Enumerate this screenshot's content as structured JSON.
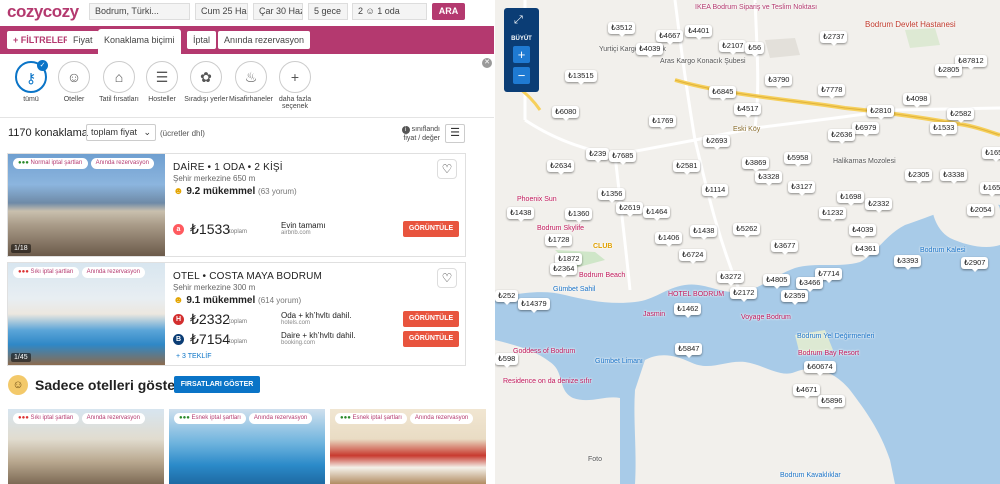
{
  "header": {
    "logo": "cozycozy",
    "destination": "Bodrum, Türki...",
    "checkin": "Cum 25 Haz",
    "checkout": "Çar 30 Haz",
    "nights": "5 gece",
    "guests": "2 ☺ 1 oda",
    "search_button": "ARA"
  },
  "filters": {
    "main": "+ FİLTRELER",
    "tabs": [
      "Fiyat",
      "Konaklama biçimi",
      "İptal",
      "Anında rezervasyon"
    ]
  },
  "categories": [
    {
      "label": "tümü",
      "icon": "key-icon",
      "glyph": "⚷"
    },
    {
      "label": "Oteller",
      "icon": "bellboy-icon",
      "glyph": "☺"
    },
    {
      "label": "Tatil fırsatları",
      "icon": "building-icon",
      "glyph": "⌂"
    },
    {
      "label": "Hosteller",
      "icon": "bunkbed-icon",
      "glyph": "☰"
    },
    {
      "label": "Sıradışı yerler",
      "icon": "unusual-icon",
      "glyph": "✿"
    },
    {
      "label": "Misafirhaneler",
      "icon": "guesthouse-icon",
      "glyph": "♨"
    },
    {
      "label": "daha fazla seçenek",
      "icon": "plus-icon",
      "glyph": "+"
    }
  ],
  "results": {
    "count": "1170 konaklama",
    "sort": "toplam fiyat",
    "fees": "(ücretler dhl)",
    "classification": "sınıflandı fiyat / değer"
  },
  "listings": [
    {
      "badges": [
        "Normal iptal şartları",
        "Anında rezervasyon"
      ],
      "photo_count": "1/18",
      "title": "DAİRE • 1 ODA • 2 KİŞİ",
      "distance": "Şehir merkezine 650 m",
      "rating": "9.2 mükemmel",
      "reviews": "(63 yorum)",
      "offers": [
        {
          "provider": "airbnb-icon",
          "provider_glyph": "a",
          "color": "#ff5a5f",
          "price": "₺1533",
          "type": "toplam",
          "desc": "Evin tamamı",
          "source": "airbnb.com",
          "button": "GÖRÜNTÜLE"
        }
      ]
    },
    {
      "badges": [
        "Sıkı iptal şartları",
        "Anında rezervasyon"
      ],
      "photo_count": "1/45",
      "title": "OTEL • COSTA MAYA BODRUM",
      "distance": "Şehir merkezine 300 m",
      "rating": "9.1 mükemmel",
      "reviews": "(614 yorum)",
      "offers": [
        {
          "provider": "hotels-icon",
          "provider_glyph": "H",
          "color": "#d32f2f",
          "price": "₺2332",
          "type": "toplam",
          "desc": "Oda + kh’hvltı dahil.",
          "source": "hotels.com",
          "button": "GÖRÜNTÜLE"
        },
        {
          "provider": "booking-icon",
          "provider_glyph": "B",
          "color": "#0b3d75",
          "price": "₺7154",
          "type": "toplam",
          "desc": "Daire + kh’hvltı dahil.",
          "source": "booking.com",
          "button": "GÖRÜNTÜLE"
        }
      ],
      "more": "+ 3 TEKLİF"
    }
  ],
  "hotels_banner": {
    "text": "Sadece otelleri göster",
    "button": "FIRSATLARI GÖSTER"
  },
  "thumbnails": [
    {
      "badges": [
        "Sıkı iptal şartları",
        "Anında rezervasyon"
      ]
    },
    {
      "badges": [
        "Esnek iptal şartları",
        "Anında rezervasyon"
      ]
    },
    {
      "badges": [
        "Esnek iptal şartları",
        "Anında rezervasyon"
      ]
    }
  ],
  "map": {
    "expand_label": "BÜYÜT",
    "zoom_in": "+",
    "zoom_out": "−",
    "places": [
      "IKEA Bodrum Sipariş ve Teslim Noktası",
      "Yurtiçi Kargo Konacık",
      "Aras Kargo Konacık Şubesi",
      "Bodrum Devlet Hastanesi",
      "Eski Köy",
      "Halikarnas Mozolesi",
      "Phoenix Sun",
      "Bodrum Skylife",
      "Bodrum Beach",
      "Gümbet Sahil",
      "HOTEL BODRUM",
      "Voyage Bodrum",
      "Bodrum Yel Değirmenleri",
      "Bodrum Bay Resort",
      "Bodrum Kalesi",
      "Goddess of Bodrum",
      "Residence on da denize sıfır",
      "Gümbet Limanı",
      "Foto",
      "Bodrum Kavaklıklar",
      "CLUB",
      "Jasmin"
    ],
    "prices": [
      "₺3512",
      "₺4667",
      "₺4401",
      "₺4039",
      "₺2107",
      "₺56",
      "₺2737",
      "₺87812",
      "₺2805",
      "₺13515",
      "₺3790",
      "₺6845",
      "₺7778",
      "₺4098",
      "₺4517",
      "₺2810",
      "₺2582",
      "₺6080",
      "₺1769",
      "₺6979",
      "₺1533",
      "₺2693",
      "₺2636",
      "₺2634",
      "₺239",
      "₺7685",
      "₺2581",
      "₺3869",
      "₺5958",
      "₺1656",
      "₺2305",
      "₺3338",
      "₺3328",
      "₺3127",
      "₺165",
      "₺1356",
      "₺1114",
      "₺2619",
      "₺1698",
      "₺2332",
      "₺1438",
      "₺1360",
      "₺1464",
      "₺1232",
      "₺2054",
      "₺4039",
      "₺1406",
      "₺1438",
      "₺5262",
      "₺1728",
      "₺3677",
      "₺4361",
      "₺1872",
      "₺6724",
      "₺3393",
      "₺2907",
      "₺2364",
      "₺3272",
      "₺4805",
      "₺7714",
      "₺3466",
      "₺2172",
      "₺2359",
      "₺252",
      "₺14379",
      "₺1462",
      "₺5847",
      "₺598",
      "₺60674",
      "₺4671",
      "₺5896"
    ]
  },
  "colors": {
    "brand": "#b4396f",
    "accent_blue": "#0a74c7",
    "view_button": "#e8543e",
    "map_control": "#0b3d75",
    "sea": "#a8cbe8",
    "land": "#f2f0ec"
  }
}
